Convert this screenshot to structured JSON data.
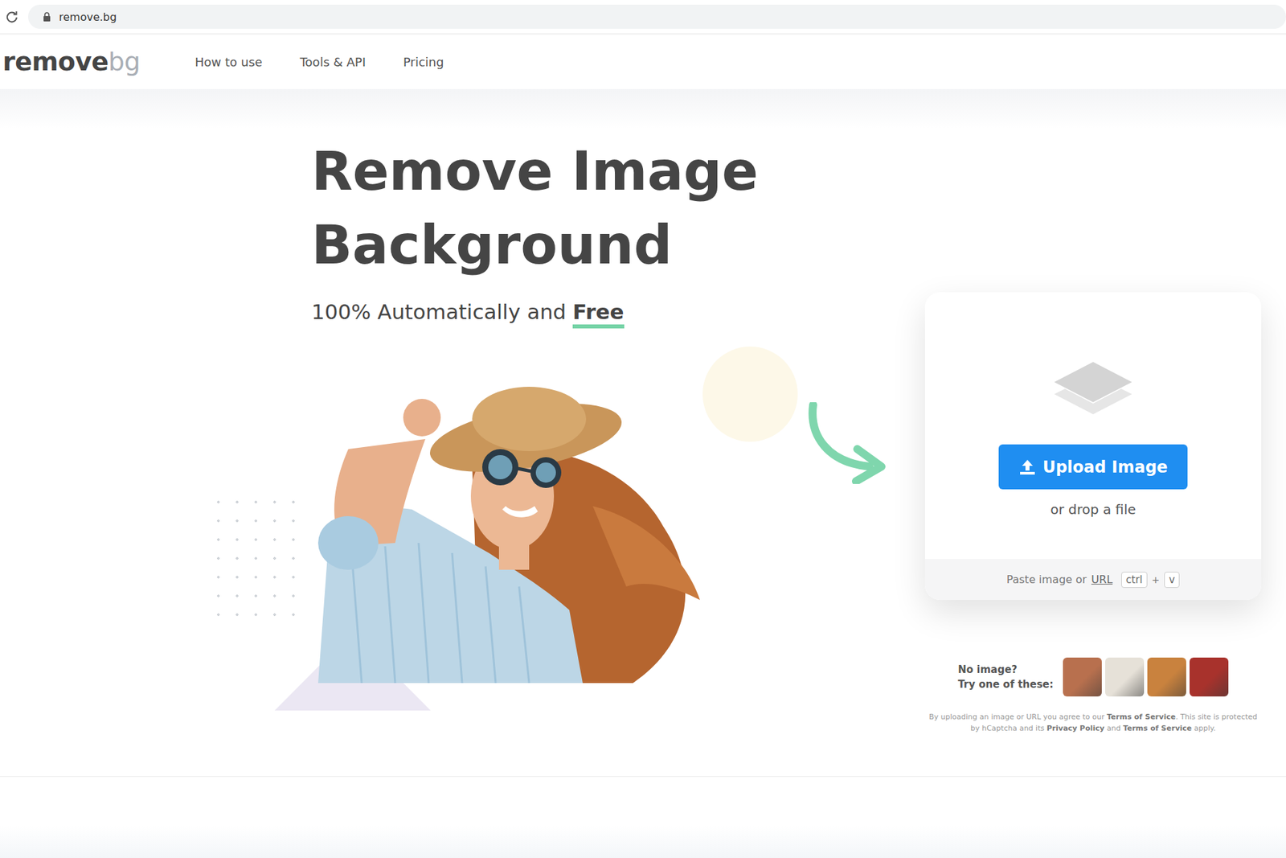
{
  "browser": {
    "url": "remove.bg"
  },
  "logo": {
    "primary": "remove",
    "secondary": "bg"
  },
  "nav": [
    {
      "label": "How to use"
    },
    {
      "label": "Tools & API"
    },
    {
      "label": "Pricing"
    }
  ],
  "hero": {
    "title_lines": [
      "Remove Image",
      "Background"
    ],
    "subtitle": "100% Automatically and",
    "subtitle_emphasis": "Free"
  },
  "upload": {
    "button": "Upload Image",
    "hint": "or drop a file",
    "paste_label": "Paste image or",
    "paste_link": "URL",
    "keys": [
      "ctrl",
      "v"
    ],
    "key_joiner": "+"
  },
  "samples": {
    "label_lines": [
      "No image?",
      "Try one of these:"
    ],
    "items": [
      {
        "color": "#b8704e"
      },
      {
        "color": "#e6e1d8"
      },
      {
        "color": "#c9823e"
      },
      {
        "color": "#a8322c"
      }
    ]
  },
  "legal": [
    {
      "text": "By uploading an image or URL you agree to our ",
      "bold": false
    },
    {
      "text": "Terms of Service",
      "bold": true
    },
    {
      "text": ". This site is protected by hCaptcha and its ",
      "bold": false
    },
    {
      "text": "Privacy Policy",
      "bold": true
    },
    {
      "text": " and ",
      "bold": false
    },
    {
      "text": "Terms of Service",
      "bold": true
    },
    {
      "text": " apply.",
      "bold": false
    }
  ]
}
